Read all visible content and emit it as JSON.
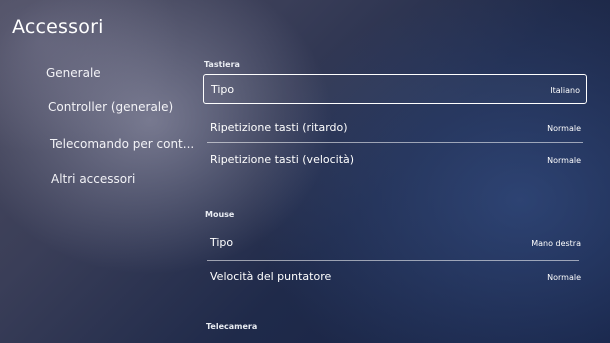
{
  "header": {
    "title": "Accessori"
  },
  "sidebar": {
    "items": [
      {
        "label": "Generale"
      },
      {
        "label": "Controller (generale)"
      },
      {
        "label": "Telecomando per cont..."
      },
      {
        "label": "Altri accessori"
      }
    ]
  },
  "sections": {
    "keyboard": {
      "heading": "Tastiera",
      "rows": [
        {
          "label": "Tipo",
          "value": "Italiano"
        },
        {
          "label": "Ripetizione tasti (ritardo)",
          "value": "Normale"
        },
        {
          "label": "Ripetizione tasti (velocità)",
          "value": "Normale"
        }
      ]
    },
    "mouse": {
      "heading": "Mouse",
      "rows": [
        {
          "label": "Tipo",
          "value": "Mano destra"
        },
        {
          "label": "Velocità del puntatore",
          "value": "Normale"
        }
      ]
    },
    "camera": {
      "heading": "Telecamera"
    }
  }
}
